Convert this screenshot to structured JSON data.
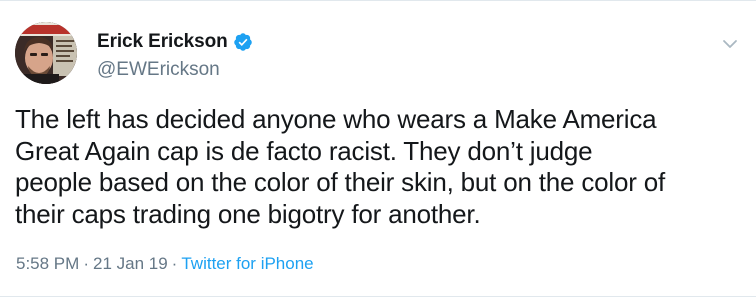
{
  "tweet": {
    "author": {
      "name": "Erick Erickson",
      "handle": "@EWErickson",
      "verified": true
    },
    "text_lines": [
      "The left has decided anyone who wears a Make America",
      "Great Again cap is de facto racist. They don’t judge",
      "people based on the color of their skin, but on the color of",
      "their caps trading one bigotry for another."
    ],
    "time": "5:58 PM",
    "date": "21 Jan 19",
    "source": "Twitter for iPhone",
    "separator": "·"
  },
  "colors": {
    "text": "#14171a",
    "muted": "#657786",
    "accent": "#1da1f2",
    "border": "#e1e8ed"
  },
  "icons": {
    "verified": "verified-badge-icon",
    "menu": "chevron-down-icon"
  }
}
